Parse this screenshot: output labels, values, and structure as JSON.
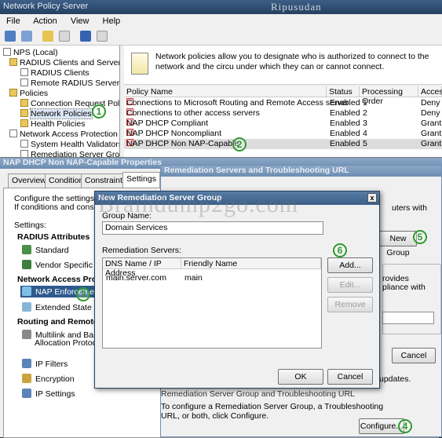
{
  "nps": {
    "title": "Network Policy Server",
    "user_caption": "Ripusudan",
    "menu": [
      "File",
      "Action",
      "View",
      "Help"
    ],
    "tree": {
      "root": "NPS (Local)",
      "radius_group": "RADIUS Clients and Servers",
      "radius_clients": "RADIUS Clients",
      "remote_radius": "Remote RADIUS Server G",
      "policies": "Policies",
      "conn_request": "Connection Request Polici",
      "network_policies": "Network Policies",
      "health_policies": "Health Policies",
      "nap": "Network Access Protection",
      "shv": "System Health Validators",
      "remediation_groups": "Remediation Server Group"
    },
    "info_text": "Network policies allow you to designate who is authorized to connect to the network and the circu under which they can or cannot connect.",
    "columns": [
      "Policy Name",
      "Status",
      "Processing Order",
      "Access"
    ],
    "rows": [
      {
        "name": "Connections to Microsoft Routing and Remote Access server",
        "status": "Enabled",
        "order": "1",
        "access": "Deny A"
      },
      {
        "name": "Connections to other access servers",
        "status": "Enabled",
        "order": "2",
        "access": "Deny A"
      },
      {
        "name": "NAP DHCP Compliant",
        "status": "Enabled",
        "order": "3",
        "access": "Grant A"
      },
      {
        "name": "NAP DHCP Noncompliant",
        "status": "Enabled",
        "order": "4",
        "access": "Grant A"
      },
      {
        "name": "NAP DHCP Non NAP-Capable",
        "status": "Enabled",
        "order": "5",
        "access": "Grant A"
      }
    ]
  },
  "props": {
    "title": "NAP DHCP Non NAP-Capable Properties",
    "tabs": [
      "Overview",
      "Conditions",
      "Constraints",
      "Settings"
    ],
    "desc1": "Configure the settings for th",
    "desc2": "If conditions and constraint",
    "settings_label": "Settings:",
    "radius_head": "RADIUS Attributes",
    "standard": "Standard",
    "vendor": "Vendor Specific",
    "nap_head": "Network Access Prote",
    "nap_enforce": "NAP Enforcement",
    "ext_state": "Extended State",
    "routing_head": "Routing and Remote A",
    "multilink1": "Multilink and Bandv",
    "multilink2": "Allocation Protocol",
    "ip_filters": "IP Filters",
    "encryption": "Encryption",
    "ip_settings": "IP Settings"
  },
  "remed": {
    "title": "Remediation Servers and Troubleshooting URL",
    "right_text1": "uters with",
    "new_group": "New Group",
    "provides": "rovides",
    "pliance_with": "pliance with",
    "cancel": "Cancel",
    "updates": "updates.",
    "group_heading": "Remediation Server Group and Troubleshooting URL",
    "configure_text": "To configure a Remediation Server Group, a Troubleshooting URL, or both, click Configure.",
    "configure": "Configure..."
  },
  "nrsg": {
    "title": "New Remediation Server Group",
    "close": "x",
    "group_name_label": "Group Name:",
    "group_name_value": "Domain Services",
    "servers_label": "Remediation Servers:",
    "columns": [
      "DNS Name / IP Address",
      "Friendly Name"
    ],
    "rows": [
      {
        "dns": "main.server.com",
        "friendly": "main"
      }
    ],
    "add": "Add...",
    "edit": "Edit...",
    "remove": "Remove",
    "ok": "OK",
    "cancel": "Cancel"
  },
  "watermark": "Braindump2go.com",
  "steps": [
    "1",
    "2",
    "3",
    "4",
    "5",
    "6"
  ]
}
